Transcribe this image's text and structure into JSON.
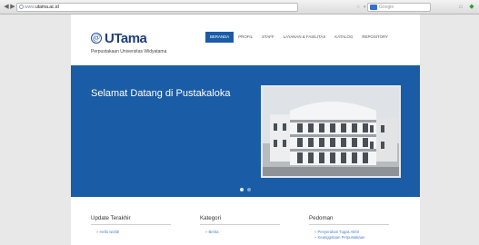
{
  "browser": {
    "url_prefix": "www.",
    "url_domain": "utama.ac.id",
    "search_placeholder": "Google",
    "back_icon": "back-arrow-icon",
    "forward_icon": "forward-arrow-icon",
    "home_icon": "home-icon"
  },
  "header": {
    "logo_mark": "@",
    "logo_text": "UTama",
    "logo_subtitle": "Perpustakaan Universitas Widyatama",
    "menu": [
      {
        "label": "Beranda",
        "active": true
      },
      {
        "label": "Profil",
        "active": false
      },
      {
        "label": "Staff",
        "active": false
      },
      {
        "label": "Layanan & Fasilitas",
        "active": false
      },
      {
        "label": "Katalog",
        "active": false
      },
      {
        "label": "Repository",
        "active": false
      }
    ]
  },
  "hero": {
    "title": "Selamat Datang di Pustakaloka",
    "slides": [
      true,
      false
    ]
  },
  "widgets": [
    {
      "title": "Update Terakhir",
      "items": [
        "Hello world!"
      ]
    },
    {
      "title": "Kategori",
      "items": [
        "Berita"
      ]
    },
    {
      "title": "Pedoman",
      "items": [
        "Penyerahan Tugas Akhir",
        "Keanggotaan Perpustakaan"
      ]
    }
  ],
  "colors": {
    "primary": "#1a5ca6",
    "link": "#4a7fbf"
  }
}
